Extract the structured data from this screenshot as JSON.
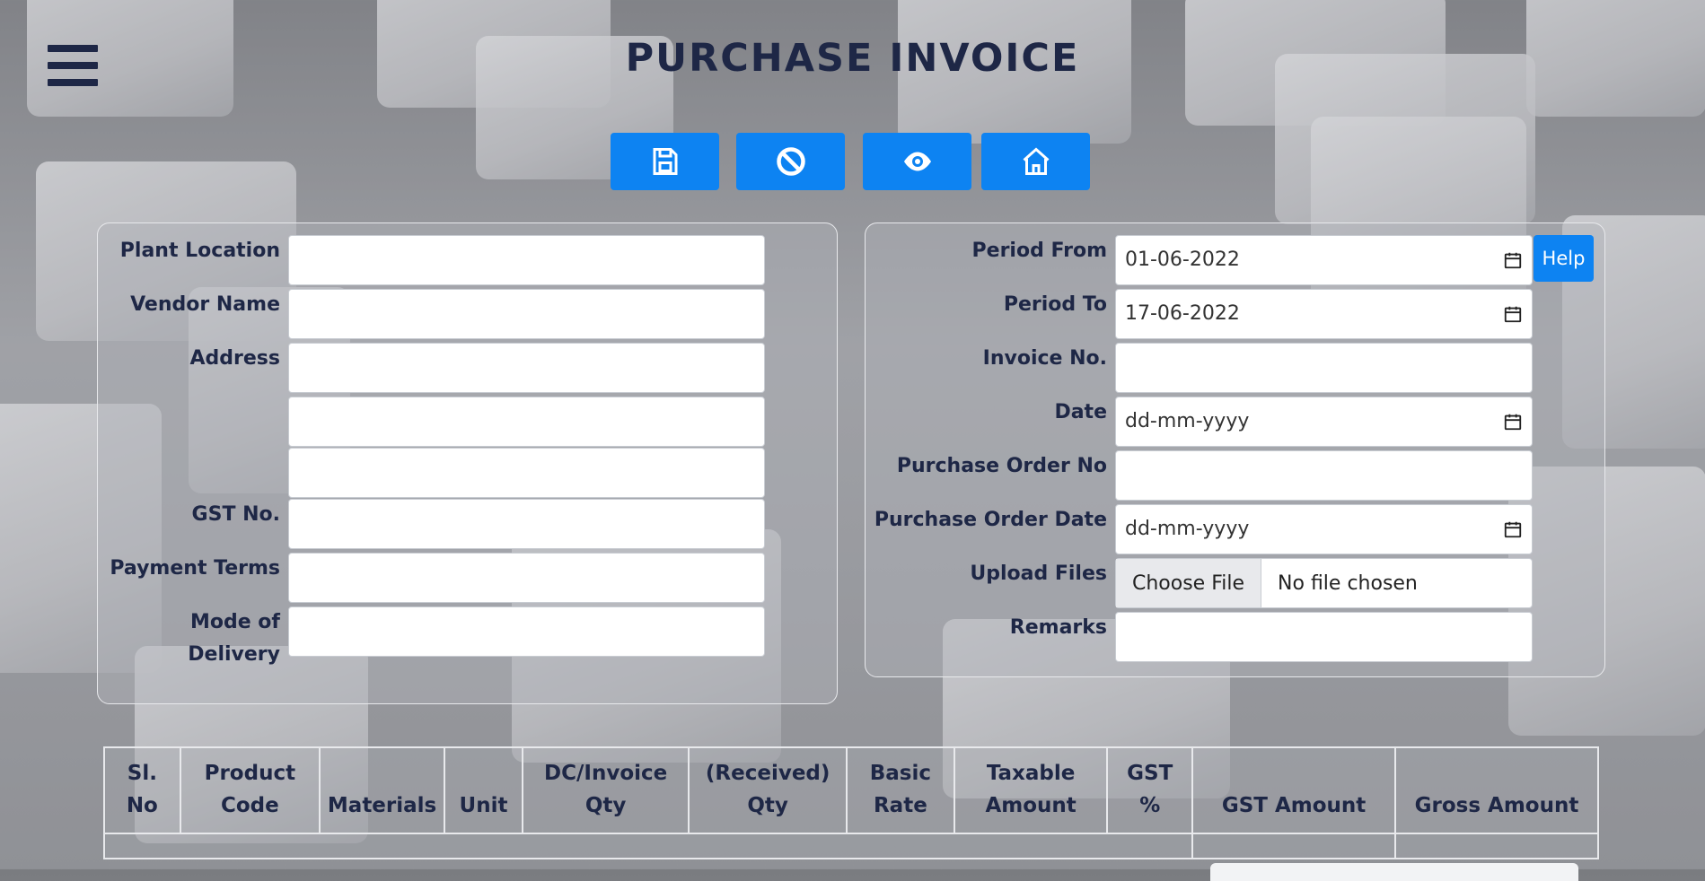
{
  "page": {
    "title": "PURCHASE INVOICE"
  },
  "toolbar": {
    "buttons": [
      {
        "name": "save",
        "icon": "floppy-disk-icon"
      },
      {
        "name": "cancel",
        "icon": "ban-icon"
      },
      {
        "name": "view",
        "icon": "eye-icon"
      },
      {
        "name": "home",
        "icon": "home-icon"
      }
    ],
    "accent": "#0d83f2"
  },
  "left_form": {
    "plant_location": {
      "label": "Plant Location",
      "value": ""
    },
    "vendor_name": {
      "label": "Vendor Name",
      "value": ""
    },
    "address": {
      "label": "Address",
      "line1": "",
      "line2": "",
      "line3": ""
    },
    "gst_no": {
      "label": "GST No.",
      "value": ""
    },
    "payment_terms": {
      "label": "Payment Terms",
      "value": ""
    },
    "mode_of_delivery": {
      "label_line1": "Mode of",
      "label_line2": "Delivery",
      "value": ""
    }
  },
  "right_form": {
    "period_from": {
      "label": "Period From",
      "value": "01-06-2022"
    },
    "help": {
      "label": "Help"
    },
    "period_to": {
      "label": "Period To",
      "value": "17-06-2022"
    },
    "invoice_no": {
      "label": "Invoice No.",
      "value": ""
    },
    "date": {
      "label": "Date",
      "placeholder": "dd-mm-yyyy"
    },
    "purchase_order_no": {
      "label": "Purchase Order No",
      "value": ""
    },
    "purchase_order_date": {
      "label": "Purchase Order Date",
      "placeholder": "dd-mm-yyyy"
    },
    "upload_files": {
      "label": "Upload Files",
      "button": "Choose File",
      "status": "No file chosen"
    },
    "remarks": {
      "label": "Remarks",
      "value": ""
    }
  },
  "table": {
    "headers": [
      {
        "l1": "Sl.",
        "l2": "No"
      },
      {
        "l1": "Product",
        "l2": "Code"
      },
      {
        "l1": "",
        "l2": "Materials"
      },
      {
        "l1": "",
        "l2": "Unit"
      },
      {
        "l1": "DC/Invoice",
        "l2": "Qty"
      },
      {
        "l1": "(Received)",
        "l2": "Qty"
      },
      {
        "l1": "Basic",
        "l2": "Rate"
      },
      {
        "l1": "Taxable",
        "l2": "Amount"
      },
      {
        "l1": "GST",
        "l2": "%"
      },
      {
        "l1": "",
        "l2": "GST Amount"
      },
      {
        "l1": "",
        "l2": "Gross Amount"
      }
    ]
  },
  "colors": {
    "text_dark": "#1e2746",
    "button_blue": "#0d83f2"
  }
}
